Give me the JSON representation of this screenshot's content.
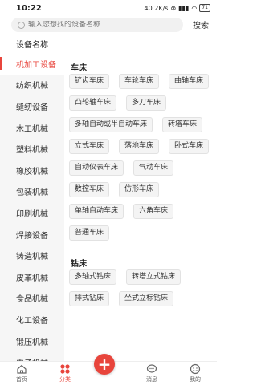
{
  "status": {
    "time": "10:22",
    "net": "40.2K/s",
    "battery": "71"
  },
  "search": {
    "placeholder": "输入您想找的设备名称",
    "button": "搜索"
  },
  "section_title": "设备名称",
  "sidebar": {
    "items": [
      {
        "label": "机加工设备",
        "active": true
      },
      {
        "label": "纺织机械"
      },
      {
        "label": "缝纫设备"
      },
      {
        "label": "木工机械"
      },
      {
        "label": "塑料机械"
      },
      {
        "label": "橡胶机械"
      },
      {
        "label": "包装机械"
      },
      {
        "label": "印刷机械"
      },
      {
        "label": "焊接设备"
      },
      {
        "label": "铸造机械"
      },
      {
        "label": "皮革机械"
      },
      {
        "label": "食品机械"
      },
      {
        "label": "化工设备"
      },
      {
        "label": "锻压机械"
      },
      {
        "label": "电子机械"
      }
    ]
  },
  "categories": [
    {
      "title": "车床",
      "items": [
        "铲齿车床",
        "车轮车床",
        "曲轴车床",
        "凸轮轴车床",
        "多刀车床",
        "多轴自动或半自动车床",
        "转塔车床",
        "立式车床",
        "落地车床",
        "卧式车床",
        "自动仪表车床",
        "气动车床",
        "数控车床",
        "仿形车床",
        "单轴自动车床",
        "六角车床",
        "普通车床"
      ]
    },
    {
      "title": "钻床",
      "items": [
        "多轴式钻床",
        "转塔立式钻床",
        "排式钻床",
        "坐式立标钻床"
      ]
    }
  ],
  "tabbar": {
    "items": [
      {
        "label": "首页",
        "icon": "home-icon"
      },
      {
        "label": "分类",
        "icon": "category-icon",
        "active": true
      },
      {
        "label": "消息",
        "icon": "message-icon"
      },
      {
        "label": "我的",
        "icon": "profile-icon"
      }
    ],
    "fab": "+"
  },
  "colors": {
    "accent": "#e8453c",
    "sidebar_bg": "#f6f6f6",
    "chip_bg": "#f4f4f4"
  }
}
